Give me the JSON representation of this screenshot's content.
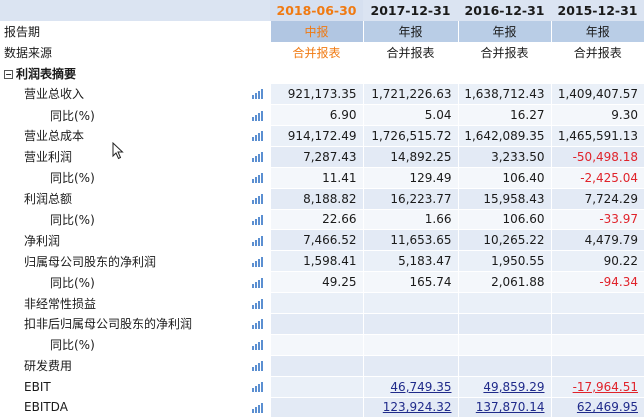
{
  "header": {
    "dates": [
      "2018-06-30",
      "2017-12-31",
      "2016-12-31",
      "2015-12-31"
    ]
  },
  "meta": {
    "period_label": "报告期",
    "period_values": [
      "中报",
      "年报",
      "年报",
      "年报"
    ],
    "source_label": "数据来源",
    "source_values": [
      "合并报表",
      "合并报表",
      "合并报表",
      "合并报表"
    ]
  },
  "section": {
    "toggle": "−",
    "title": "利润表摘要"
  },
  "rows": [
    {
      "label": "营业总收入",
      "indent": 1,
      "values": [
        "921,173.35",
        "1,721,226.63",
        "1,638,712.43",
        "1,409,407.57"
      ]
    },
    {
      "label": "同比(%)",
      "indent": 2,
      "values": [
        "6.90",
        "5.04",
        "16.27",
        "9.30"
      ]
    },
    {
      "label": "营业总成本",
      "indent": 1,
      "values": [
        "914,172.49",
        "1,726,515.72",
        "1,642,089.35",
        "1,465,591.13"
      ]
    },
    {
      "label": "营业利润",
      "indent": 1,
      "values": [
        "7,287.43",
        "14,892.25",
        "3,233.50",
        "-50,498.18"
      ]
    },
    {
      "label": "同比(%)",
      "indent": 2,
      "values": [
        "11.41",
        "129.49",
        "106.40",
        "-2,425.04"
      ]
    },
    {
      "label": "利润总额",
      "indent": 1,
      "values": [
        "8,188.82",
        "16,223.77",
        "15,958.43",
        "7,724.29"
      ]
    },
    {
      "label": "同比(%)",
      "indent": 2,
      "values": [
        "22.66",
        "1.66",
        "106.60",
        "-33.97"
      ]
    },
    {
      "label": "净利润",
      "indent": 1,
      "values": [
        "7,466.52",
        "11,653.65",
        "10,265.22",
        "4,479.79"
      ]
    },
    {
      "label": "归属母公司股东的净利润",
      "indent": 1,
      "values": [
        "1,598.41",
        "5,183.47",
        "1,950.55",
        "90.22"
      ]
    },
    {
      "label": "同比(%)",
      "indent": 2,
      "values": [
        "49.25",
        "165.74",
        "2,061.88",
        "-94.34"
      ]
    },
    {
      "label": "非经常性损益",
      "indent": 1,
      "values": [
        "",
        "",
        "",
        ""
      ]
    },
    {
      "label": "扣非后归属母公司股东的净利润",
      "indent": 1,
      "values": [
        "",
        "",
        "",
        ""
      ]
    },
    {
      "label": "同比(%)",
      "indent": 2,
      "values": [
        "",
        "",
        "",
        ""
      ]
    },
    {
      "label": "研发费用",
      "indent": 1,
      "values": [
        "",
        "",
        "",
        ""
      ]
    },
    {
      "label": "EBIT",
      "indent": 1,
      "link": true,
      "values": [
        "",
        "46,749.35",
        "49,859.29",
        "-17,964.51"
      ]
    },
    {
      "label": "EBITDA",
      "indent": 1,
      "link": true,
      "values": [
        "",
        "123,924.32",
        "137,870.14",
        "62,469.95"
      ]
    }
  ]
}
